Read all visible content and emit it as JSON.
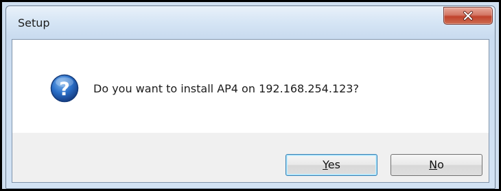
{
  "window": {
    "title": "Setup"
  },
  "message": {
    "text": "Do you want to install AP4 on 192.168.254.123?"
  },
  "buttons": {
    "yes": {
      "mnemonic": "Y",
      "rest": "es"
    },
    "no": {
      "mnemonic": "N",
      "rest": "o"
    }
  },
  "icons": {
    "close": "close-icon",
    "question": "question-icon"
  },
  "colors": {
    "close_button": "#c0432c",
    "question_icon": "#1f5fb8",
    "title_bar": "#cadcf0",
    "focused_button_border": "#3c7fb1"
  }
}
